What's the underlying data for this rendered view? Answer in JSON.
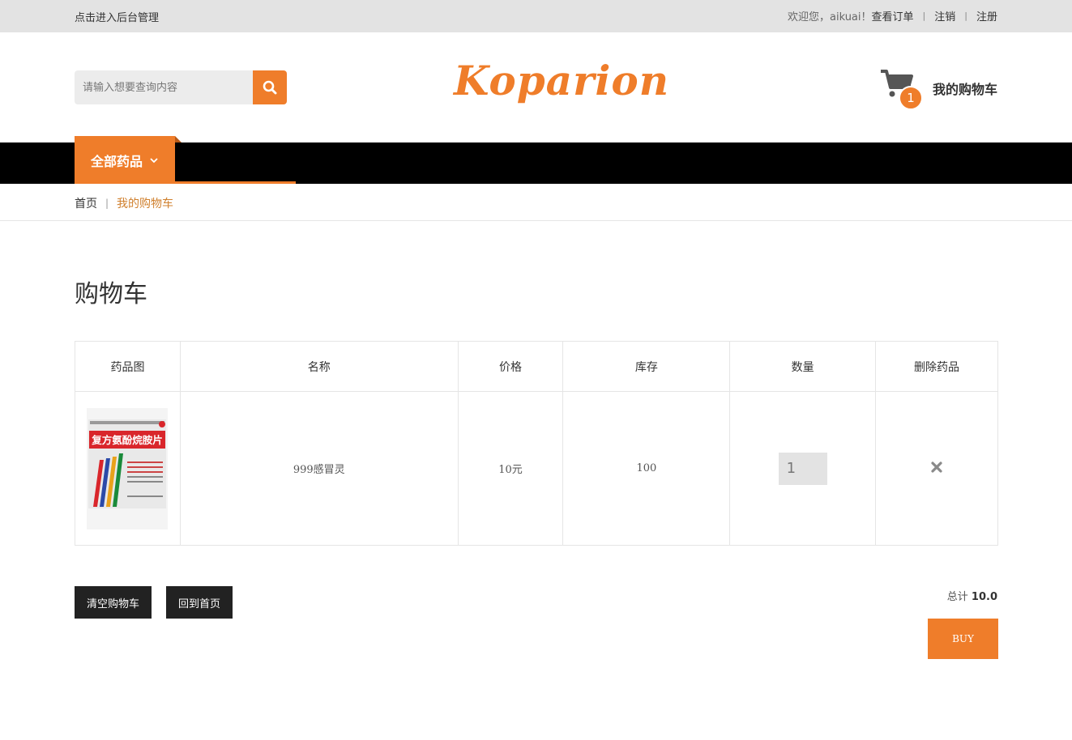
{
  "topbar": {
    "admin_link": "点击进入后台管理",
    "welcome": "欢迎您，aikuai！",
    "orders_link": "查看订单",
    "logout_link": "注销",
    "register_link": "注册",
    "separator": "|"
  },
  "header": {
    "search_placeholder": "请输入想要查询内容",
    "logo_text": "Koparion",
    "cart_count": "1",
    "cart_label": "我的购物车"
  },
  "nav": {
    "category_label": "全部药品"
  },
  "breadcrumb": {
    "home": "首页",
    "separator": "|",
    "current": "我的购物车"
  },
  "page": {
    "title": "购物车"
  },
  "table": {
    "headers": [
      "药品图",
      "名称",
      "价格",
      "库存",
      "数量",
      "删除药品"
    ],
    "rows": [
      {
        "image_text": "复方氨酚烷胺片",
        "name": "999感冒灵",
        "price": "10元",
        "stock": "100",
        "quantity": "1"
      }
    ]
  },
  "actions": {
    "clear_label": "清空购物车",
    "home_label": "回到首页",
    "total_label": "总计",
    "total_value": "10.0",
    "buy_label": "BUY"
  },
  "colors": {
    "accent": "#ef7d2a",
    "topbar_bg": "#e3e3e3",
    "nav_bg": "#000000",
    "dark_button": "#222222"
  },
  "icons": {
    "search": "search-icon",
    "cart": "cart-icon",
    "dropdown": "chevron-down-icon",
    "remove": "close-icon"
  }
}
